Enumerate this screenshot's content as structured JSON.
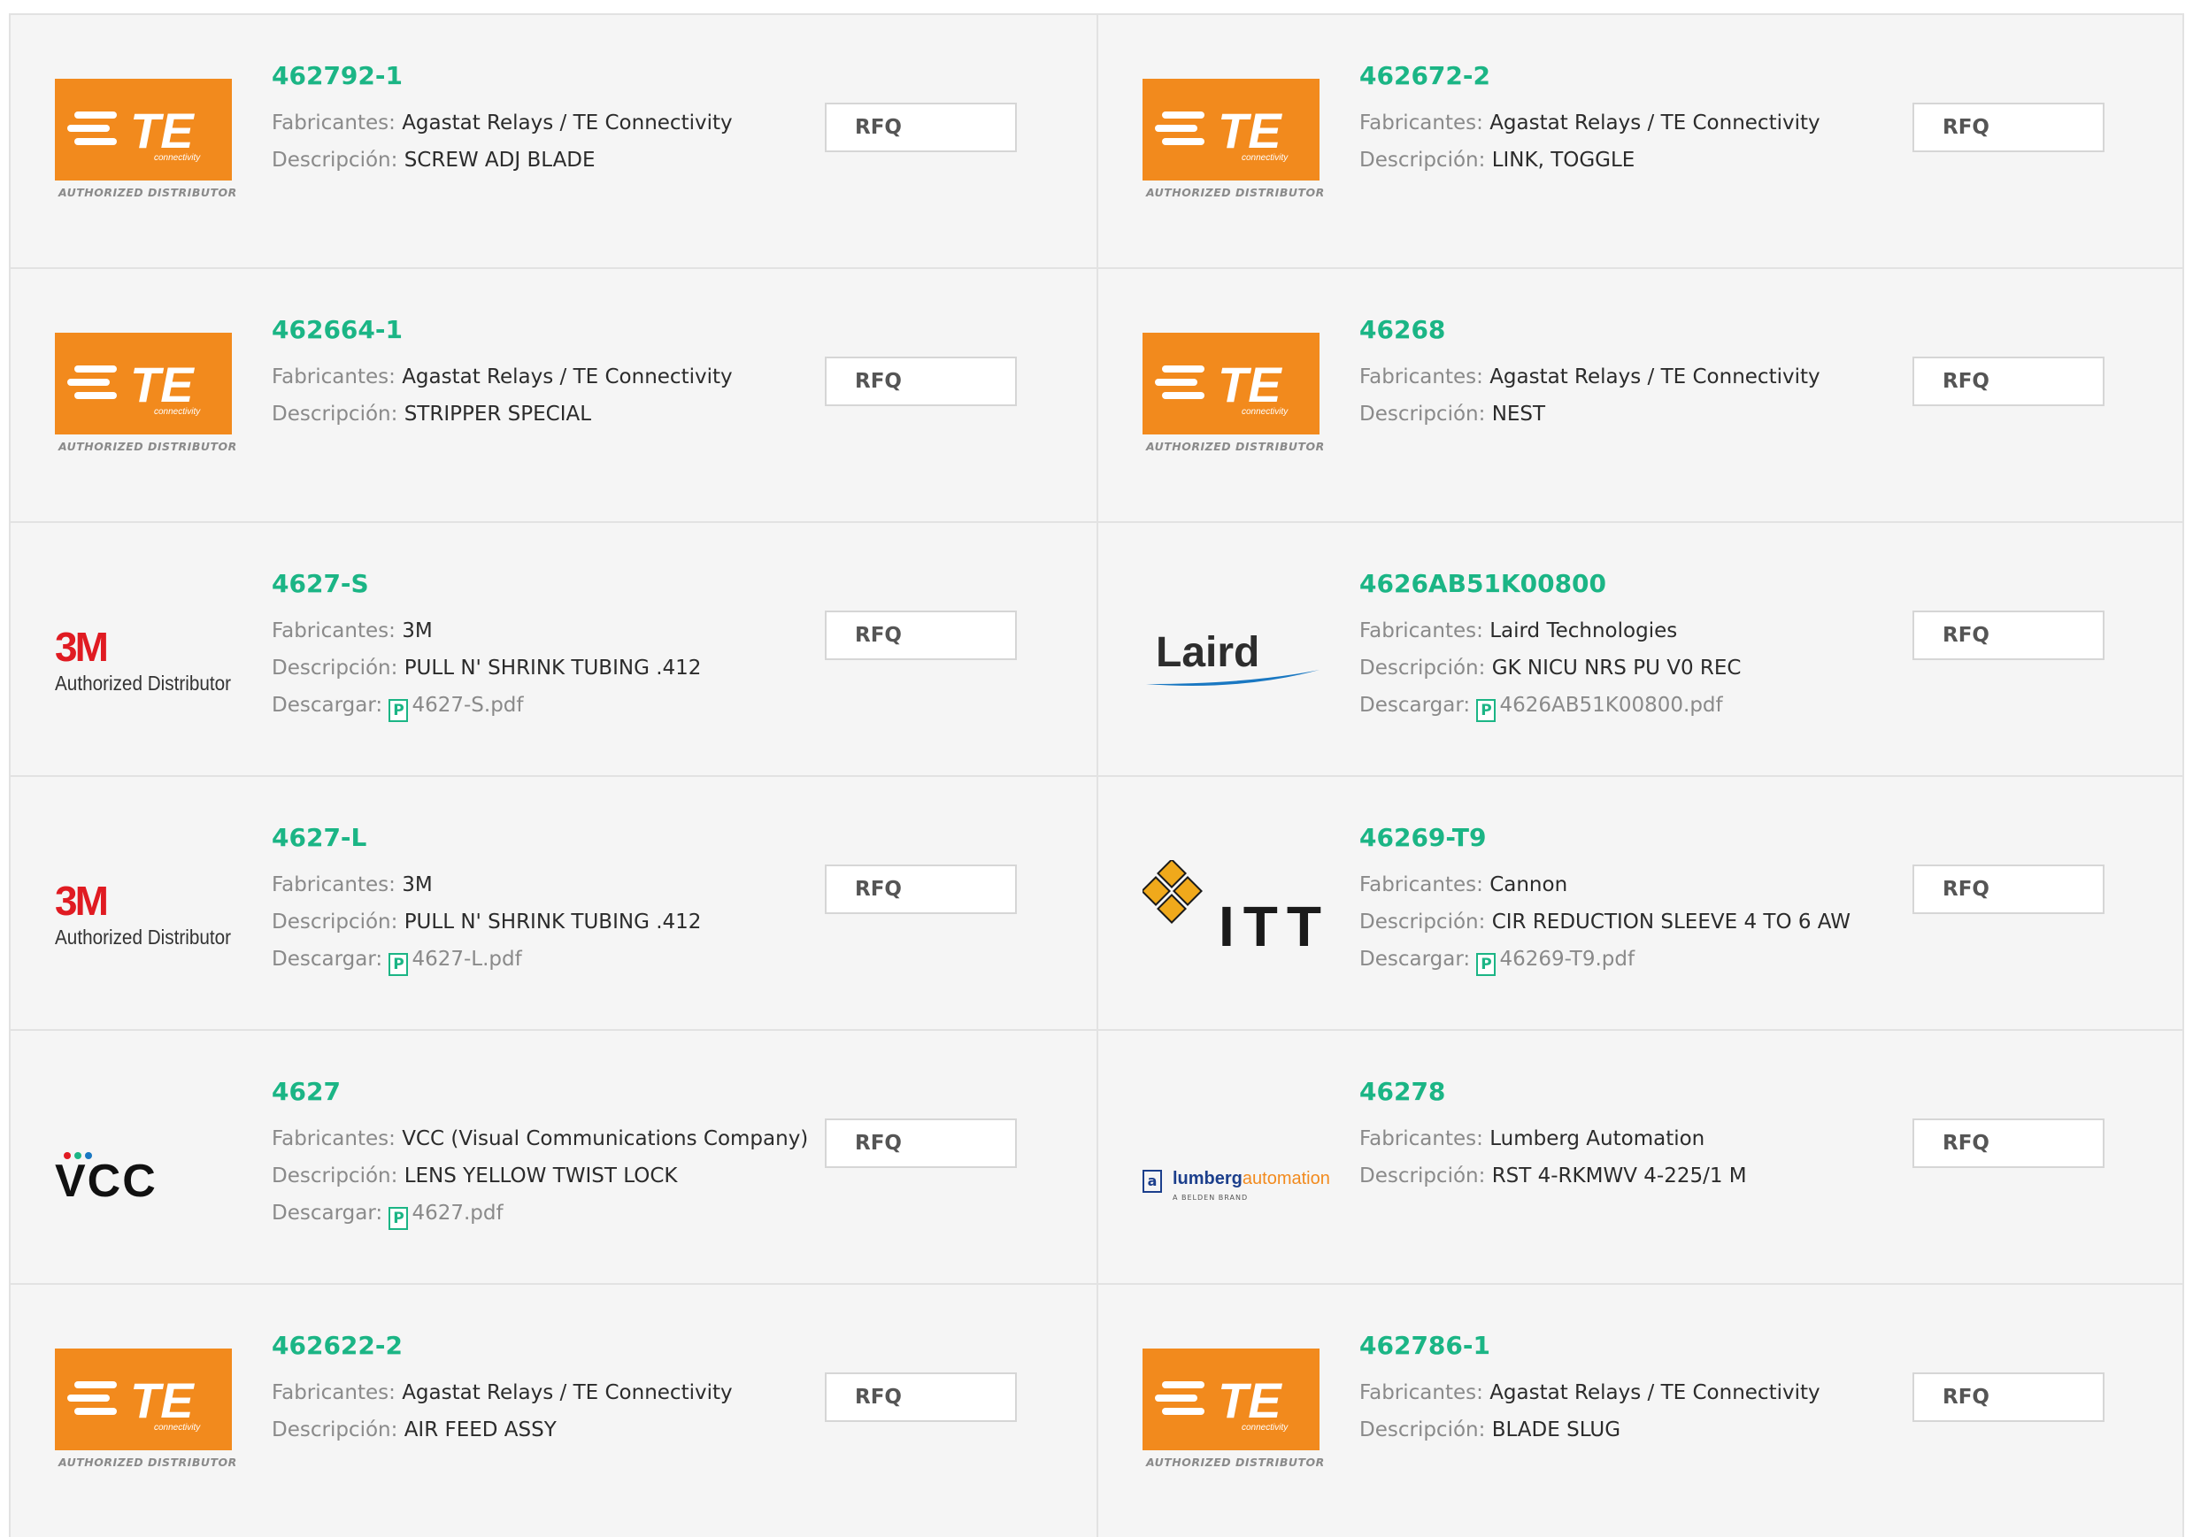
{
  "labels": {
    "manufacturer": "Fabricantes:",
    "description": "Descripción:",
    "download": "Descargar:",
    "rfq": "RFQ",
    "pdf_icon": "P"
  },
  "colors": {
    "part_link": "#1bb585",
    "te_orange": "#f28a1d",
    "m3_red": "#e01b22",
    "laird_blue": "#1a78c2",
    "itt_gold": "#f0a91b",
    "lumberg_blue": "#1c3f8c"
  },
  "logos": {
    "te": {
      "name": "TE",
      "sub": "connectivity",
      "tag": "AUTHORIZED DISTRIBUTOR"
    },
    "m3": {
      "name": "3M",
      "tag": "Authorized Distributor"
    },
    "laird": {
      "name": "Laird"
    },
    "itt": {
      "name": "ITT"
    },
    "vcc": {
      "name": "VCC"
    },
    "lumberg": {
      "box": "a",
      "name_a": "lumberg",
      "name_b": "automation",
      "sub": "A BELDEN BRAND"
    }
  },
  "products": [
    {
      "part": "462792-1",
      "logo": "te-logo",
      "manufacturer": "Agastat Relays / TE Connectivity",
      "description": "SCREW ADJ BLADE"
    },
    {
      "part": "462672-2",
      "logo": "te-logo",
      "manufacturer": "Agastat Relays / TE Connectivity",
      "description": "LINK, TOGGLE"
    },
    {
      "part": "462664-1",
      "logo": "te-logo",
      "manufacturer": "Agastat Relays / TE Connectivity",
      "description": "STRIPPER SPECIAL"
    },
    {
      "part": "46268",
      "logo": "te-logo",
      "manufacturer": "Agastat Relays / TE Connectivity",
      "description": "NEST"
    },
    {
      "part": "4627-S",
      "logo": "3m-logo",
      "manufacturer": "3M",
      "description": "PULL N' SHRINK TUBING .412",
      "pdf": "4627-S.pdf"
    },
    {
      "part": "4626AB51K00800",
      "logo": "laird-logo",
      "manufacturer": "Laird Technologies",
      "description": "GK NICU NRS PU V0 REC",
      "pdf": "4626AB51K00800.pdf"
    },
    {
      "part": "4627-L",
      "logo": "3m-logo",
      "manufacturer": "3M",
      "description": "PULL N' SHRINK TUBING .412",
      "pdf": "4627-L.pdf"
    },
    {
      "part": "46269-T9",
      "logo": "itt-logo",
      "manufacturer": "Cannon",
      "description": "CIR REDUCTION SLEEVE 4 TO 6 AW",
      "pdf": "46269-T9.pdf"
    },
    {
      "part": "4627",
      "logo": "vcc-logo",
      "manufacturer": "VCC (Visual Communications Company)",
      "description": "LENS YELLOW TWIST LOCK",
      "pdf": "4627.pdf"
    },
    {
      "part": "46278",
      "logo": "lumberg-logo",
      "manufacturer": "Lumberg Automation",
      "description": "RST 4-RKMWV 4-225/1 M"
    },
    {
      "part": "462622-2",
      "logo": "te-logo",
      "manufacturer": "Agastat Relays / TE Connectivity",
      "description": "AIR FEED ASSY"
    },
    {
      "part": "462786-1",
      "logo": "te-logo",
      "manufacturer": "Agastat Relays / TE Connectivity",
      "description": "BLADE SLUG"
    }
  ]
}
